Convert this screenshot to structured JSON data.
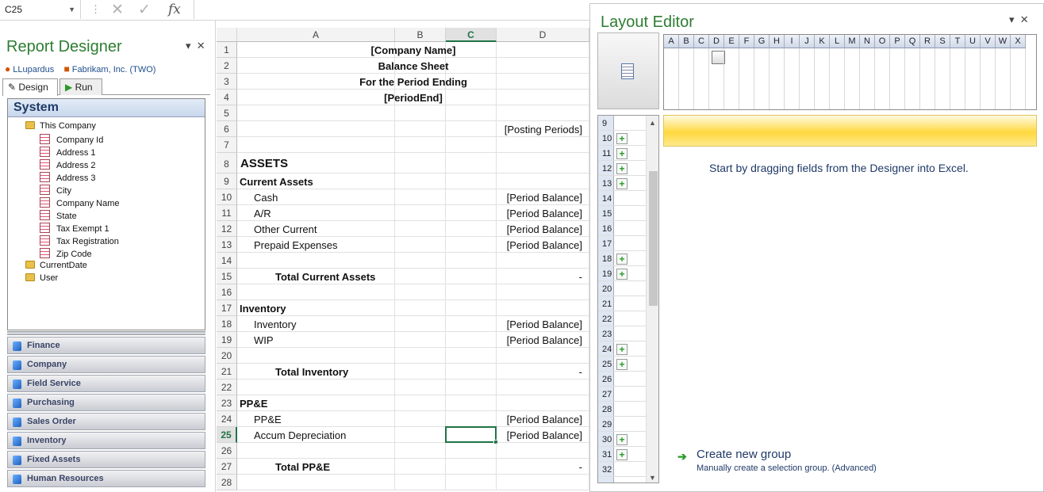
{
  "formula_bar": {
    "name_box": "C25",
    "cancel_icon": "✕",
    "enter_icon": "✓",
    "fx": "fx"
  },
  "report_designer": {
    "title": "Report Designer",
    "user": "LLupardus",
    "company": "Fabrikam, Inc. (TWO)",
    "tabs": [
      {
        "label": "Design"
      },
      {
        "label": "Run"
      }
    ],
    "tree_header": "System",
    "tree": [
      {
        "label": "This Company",
        "kind": "folder",
        "indent": 0
      },
      {
        "label": "Company Id",
        "kind": "field",
        "indent": 1
      },
      {
        "label": "Address 1",
        "kind": "field",
        "indent": 1
      },
      {
        "label": "Address 2",
        "kind": "field",
        "indent": 1
      },
      {
        "label": "Address 3",
        "kind": "field",
        "indent": 1
      },
      {
        "label": "City",
        "kind": "field",
        "indent": 1
      },
      {
        "label": "Company Name",
        "kind": "field",
        "indent": 1
      },
      {
        "label": "State",
        "kind": "field",
        "indent": 1
      },
      {
        "label": "Tax Exempt 1",
        "kind": "field",
        "indent": 1
      },
      {
        "label": "Tax Registration",
        "kind": "field",
        "indent": 1
      },
      {
        "label": "Zip Code",
        "kind": "field",
        "indent": 1
      },
      {
        "label": "CurrentDate",
        "kind": "folder",
        "indent": 0
      },
      {
        "label": "User",
        "kind": "folder",
        "indent": 0
      }
    ],
    "categories": [
      "Finance",
      "Company",
      "Field Service",
      "Purchasing",
      "Sales Order",
      "Inventory",
      "Fixed Assets",
      "Human Resources"
    ]
  },
  "sheet": {
    "columns": [
      "A",
      "B",
      "C",
      "D"
    ],
    "selected_column": "C",
    "selected_row": "25",
    "rows": [
      {
        "n": "1",
        "a": "[Company Name]",
        "style": "center-bold"
      },
      {
        "n": "2",
        "a": "Balance Sheet",
        "style": "center-bold"
      },
      {
        "n": "3",
        "a": "For the Period Ending",
        "style": "center-bold"
      },
      {
        "n": "4",
        "a": "[PeriodEnd]",
        "style": "center-bold"
      },
      {
        "n": "5"
      },
      {
        "n": "6",
        "d": "[Posting Periods]"
      },
      {
        "n": "7"
      },
      {
        "n": "8",
        "a": "ASSETS",
        "style": "heading"
      },
      {
        "n": "9",
        "a": "Current Assets",
        "style": "bold"
      },
      {
        "n": "10",
        "a": "Cash",
        "style": "indent1",
        "d": "[Period Balance]"
      },
      {
        "n": "11",
        "a": "A/R",
        "style": "indent1",
        "d": "[Period Balance]"
      },
      {
        "n": "12",
        "a": "Other Current",
        "style": "indent1",
        "d": "[Period Balance]"
      },
      {
        "n": "13",
        "a": "Prepaid Expenses",
        "style": "indent1",
        "d": "[Period Balance]"
      },
      {
        "n": "14"
      },
      {
        "n": "15",
        "a": "Total Current Assets",
        "style": "total",
        "d": "-"
      },
      {
        "n": "16"
      },
      {
        "n": "17",
        "a": "Inventory",
        "style": "bold"
      },
      {
        "n": "18",
        "a": "Inventory",
        "style": "indent1",
        "d": "[Period Balance]"
      },
      {
        "n": "19",
        "a": "WIP",
        "style": "indent1",
        "d": "[Period Balance]"
      },
      {
        "n": "20"
      },
      {
        "n": "21",
        "a": "Total Inventory",
        "style": "total",
        "d": "-"
      },
      {
        "n": "22"
      },
      {
        "n": "23",
        "a": "PP&E",
        "style": "bold"
      },
      {
        "n": "24",
        "a": "PP&E",
        "style": "indent1",
        "d": "[Period Balance]"
      },
      {
        "n": "25",
        "a": "Accum Depreciation",
        "style": "indent1",
        "d": "[Period Balance]"
      },
      {
        "n": "26"
      },
      {
        "n": "27",
        "a": "Total PP&E",
        "style": "total",
        "d": "-"
      },
      {
        "n": "28"
      }
    ]
  },
  "layout_editor": {
    "title": "Layout Editor",
    "mini_columns": [
      "A",
      "B",
      "C",
      "D",
      "E",
      "F",
      "G",
      "H",
      "I",
      "J",
      "K",
      "L",
      "M",
      "N",
      "O",
      "P",
      "Q",
      "R",
      "S",
      "T",
      "U",
      "V",
      "W",
      "X"
    ],
    "row_list": [
      {
        "n": "9",
        "plus": false
      },
      {
        "n": "10",
        "plus": true
      },
      {
        "n": "11",
        "plus": true
      },
      {
        "n": "12",
        "plus": true
      },
      {
        "n": "13",
        "plus": true
      },
      {
        "n": "14",
        "plus": false
      },
      {
        "n": "15",
        "plus": false
      },
      {
        "n": "16",
        "plus": false
      },
      {
        "n": "17",
        "plus": false
      },
      {
        "n": "18",
        "plus": true
      },
      {
        "n": "19",
        "plus": true
      },
      {
        "n": "20",
        "plus": false
      },
      {
        "n": "21",
        "plus": false
      },
      {
        "n": "22",
        "plus": false
      },
      {
        "n": "23",
        "plus": false
      },
      {
        "n": "24",
        "plus": true
      },
      {
        "n": "25",
        "plus": true
      },
      {
        "n": "26",
        "plus": false
      },
      {
        "n": "27",
        "plus": false
      },
      {
        "n": "28",
        "plus": false
      },
      {
        "n": "29",
        "plus": false
      },
      {
        "n": "30",
        "plus": true
      },
      {
        "n": "31",
        "plus": true
      },
      {
        "n": "32",
        "plus": false
      }
    ],
    "message": "Start by dragging fields from the Designer into Excel.",
    "create_group": "Create new group",
    "create_group_sub": "Manually create a selection group. (Advanced)"
  },
  "colors": {
    "accent_green": "#217346",
    "title_green": "#2e7d32",
    "link_blue": "#1f3a68"
  }
}
